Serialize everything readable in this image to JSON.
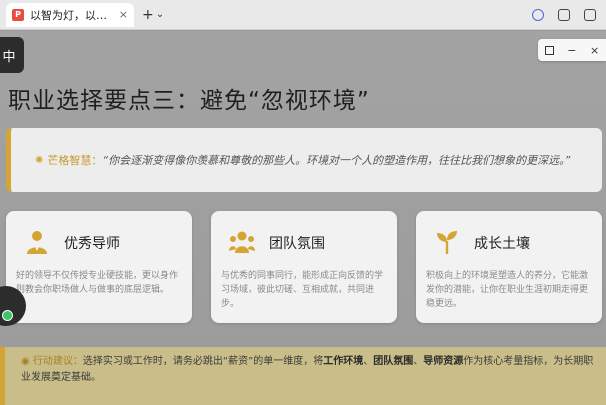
{
  "browser": {
    "tab_title": "以智为灯，以行致远——校友分",
    "tab_close": "×",
    "new_tab": "+",
    "tab_menu": "⌄",
    "favicon_text": "P"
  },
  "overlay": {
    "lang_label": "中",
    "zoom_minus": "−",
    "zoom_close": "×"
  },
  "slide": {
    "title": "职业选择要点三：避免“忽视环境”",
    "quote": {
      "label": "芒格智慧：",
      "text": "“你会逐渐变得像你羡慕和尊敬的那些人。环境对一个人的塑造作用，往往比我们想象的更深远。”"
    },
    "cards": [
      {
        "title": "优秀导师",
        "icon": "mentor-icon",
        "desc": "好的领导不仅传授专业硬技能，更以身作则教会你职场做人与做事的底层逻辑。"
      },
      {
        "title": "团队氛围",
        "icon": "team-icon",
        "desc": "与优秀的同事同行，能形成正向反馈的学习场域，彼此切磋、互相成就，共同进步。"
      },
      {
        "title": "成长土壤",
        "icon": "sprout-icon",
        "desc": "积极向上的环境是塑造人的养分，它能激发你的潜能，让你在职业生涯初期走得更稳更远。"
      }
    ],
    "action": {
      "label": "行动建议：",
      "text_before": "选择实习或工作时，请务必跳出“薪资”的单一维度，将",
      "hl1": "工作环境",
      "sep1": "、",
      "hl2": "团队氛围",
      "sep2": "、",
      "hl3": "导师资源",
      "text_after": "作为核心考量指标，为长期职业发展奠定基础。"
    }
  },
  "colors": {
    "accent": "#d4a533",
    "card_bg": "#f2f2f2",
    "slide_bg": "#9e9e9e"
  }
}
